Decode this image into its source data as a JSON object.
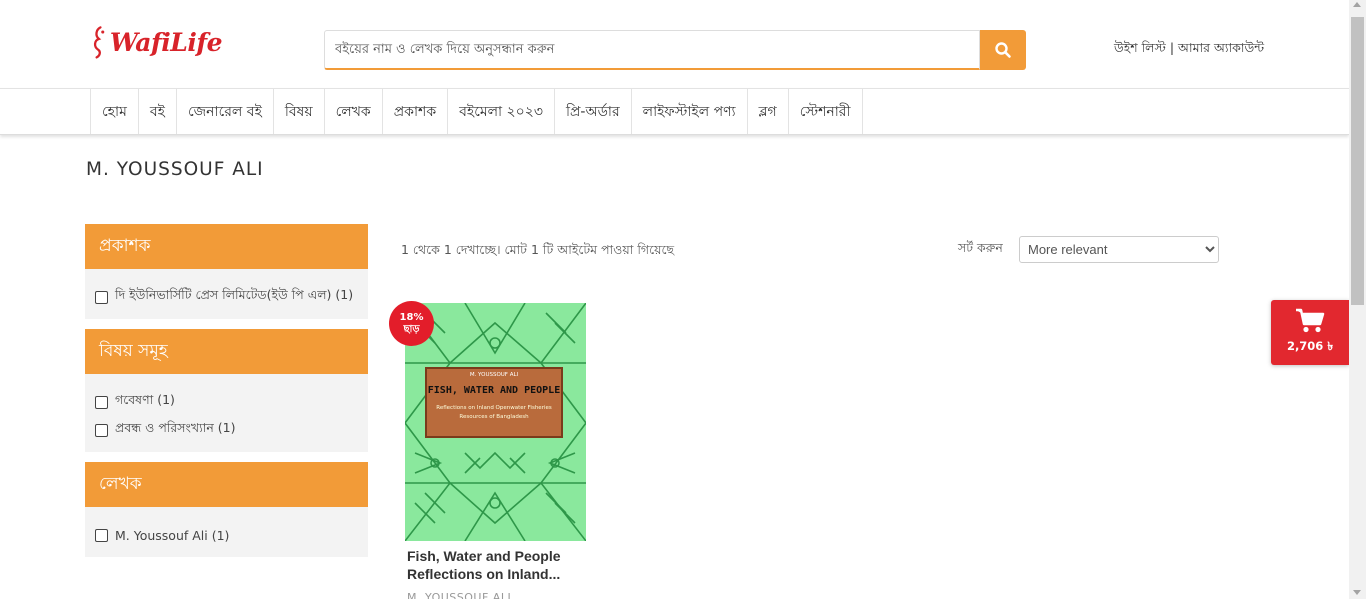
{
  "brand": {
    "logo_text": "WafiLife",
    "color": "#d8232a",
    "accent": "#f29b38"
  },
  "search": {
    "placeholder": "বইয়ের নাম ও লেখক দিয়ে অনুসন্ধান করুন",
    "button_icon": "search-icon"
  },
  "account": {
    "wishlist": "উইশ লিস্ট",
    "separator": " | ",
    "my_account": "আমার অ্যাকাউন্ট"
  },
  "nav": {
    "items": [
      "হোম",
      "বই",
      "জেনারেল বই",
      "বিষয়",
      "লেখক",
      "প্রকাশক",
      "বইমেলা ২০২৩",
      "প্রি-অর্ডার",
      "লাইফস্টাইল পণ্য",
      "ব্লগ",
      "স্টেশনারী"
    ]
  },
  "page": {
    "title": "M. YOUSSOUF ALI"
  },
  "filters": [
    {
      "heading": "প্রকাশক",
      "options": [
        {
          "label": "দি ইউনিভার্সিটি প্রেস লিমিটেড(ইউ পি এল) (1)"
        }
      ]
    },
    {
      "heading": "বিষয় সমূহ",
      "options": [
        {
          "label": "গবেষণা (1)"
        },
        {
          "label": "প্রবন্ধ ও পরিসংখ্যান (1)"
        }
      ]
    },
    {
      "heading": "লেখক",
      "options": [
        {
          "label": "M. Youssouf Ali (1)"
        }
      ]
    }
  ],
  "results": {
    "summary": "1 থেকে 1 দেখাচ্ছে। মোট 1 টি আইটেম পাওয়া গিয়েছে",
    "sort_label": "সর্ট করুন",
    "sort_value": "More relevant"
  },
  "product": {
    "discount_percent": "18%",
    "discount_word": "ছাড়",
    "cover_author": "M. YOUSSOUF ALI",
    "cover_title": "FISH, WATER AND PEOPLE",
    "cover_subtitle_1": "Reflections on Inland Openwater Fisheries",
    "cover_subtitle_2": "Resources of Bangladesh",
    "title_line1": "Fish, Water and People",
    "title_line2": "Reflections on Inland...",
    "author": "M. YOUSSOUF ALI"
  },
  "cart": {
    "icon": "shopping-cart-icon",
    "total": "2,706 ৳"
  }
}
